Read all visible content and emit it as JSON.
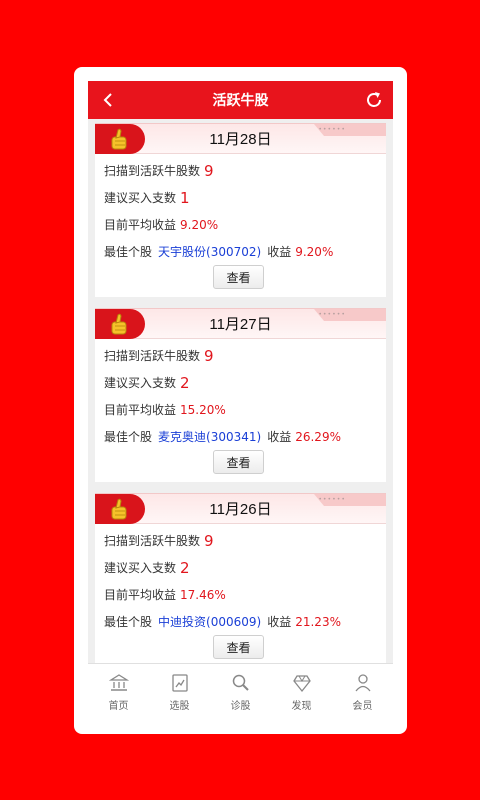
{
  "header": {
    "title": "活跃牛股",
    "back_icon": "chevron-left-icon",
    "refresh_icon": "refresh-icon"
  },
  "labels": {
    "scanned": "扫描到活跃牛股数",
    "suggest": "建议买入支数",
    "avg": "目前平均收益",
    "best": "最佳个股",
    "gain": "收益",
    "view": "查看"
  },
  "cards": [
    {
      "date": "11月28日",
      "scanned_count": "9",
      "suggest_count": "1",
      "avg_return": "9.20%",
      "best_stock": "天宇股份(300702)",
      "best_return": "9.20%"
    },
    {
      "date": "11月27日",
      "scanned_count": "9",
      "suggest_count": "2",
      "avg_return": "15.20%",
      "best_stock": "麦克奥迪(300341)",
      "best_return": "26.29%"
    },
    {
      "date": "11月26日",
      "scanned_count": "9",
      "suggest_count": "2",
      "avg_return": "17.46%",
      "best_stock": "中迪投资(000609)",
      "best_return": "21.23%"
    }
  ],
  "nav": [
    {
      "label": "首页",
      "icon": "bank-icon"
    },
    {
      "label": "选股",
      "icon": "document-chart-icon"
    },
    {
      "label": "诊股",
      "icon": "magnifier-icon"
    },
    {
      "label": "发现",
      "icon": "diamond-icon"
    },
    {
      "label": "会员",
      "icon": "member-icon"
    }
  ],
  "colors": {
    "background": "#ff0000",
    "header": "#e8141c",
    "accent_red": "#e1161d",
    "stock_blue": "#1a3fd6"
  }
}
